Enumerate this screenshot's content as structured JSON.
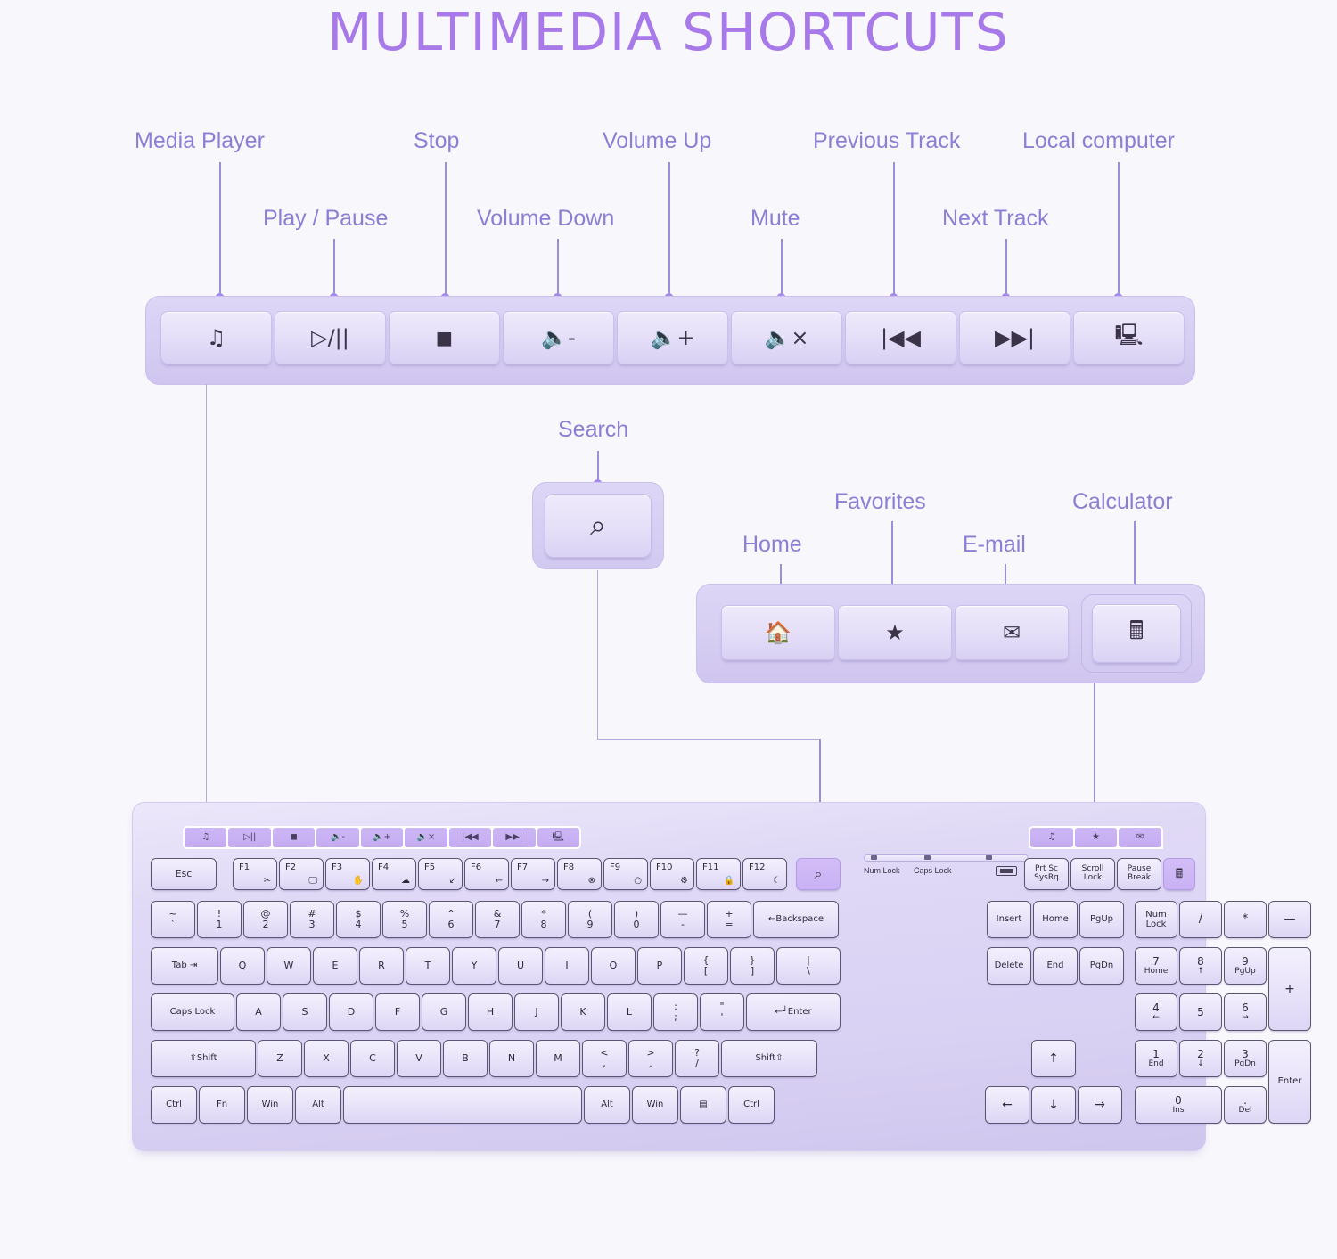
{
  "title": "MULTIMEDIA SHORTCUTS",
  "colors": {
    "background": "#f8f7fc",
    "title_purple": "#a879e8",
    "label_purple": "#8b7fd4",
    "dot_purple": "#a78bea",
    "key_face": "#eae5fa",
    "key_lit": "#cdb7f5",
    "legend_text": "#2f2a3a"
  },
  "media_bar": {
    "keys": [
      {
        "name": "media-player",
        "label": "Media Player",
        "glyph": "♫"
      },
      {
        "name": "play-pause",
        "label": "Play / Pause",
        "glyph": "▷/||"
      },
      {
        "name": "stop",
        "label": "Stop",
        "glyph": "◼"
      },
      {
        "name": "volume-down",
        "label": "Volume Down",
        "glyph": "🔈-"
      },
      {
        "name": "volume-up",
        "label": "Volume Up",
        "glyph": "🔈+"
      },
      {
        "name": "mute",
        "label": "Mute",
        "glyph": "🔈×"
      },
      {
        "name": "previous-track",
        "label": "Previous Track",
        "glyph": "|◀◀"
      },
      {
        "name": "next-track",
        "label": "Next Track",
        "glyph": "▶▶|"
      },
      {
        "name": "local-computer",
        "label": "Local computer",
        "glyph": "🖳"
      }
    ]
  },
  "search_key": {
    "label": "Search",
    "glyph": "⌕"
  },
  "app_bar": {
    "keys": [
      {
        "name": "home",
        "label": "Home",
        "glyph": "🏠"
      },
      {
        "name": "favorites",
        "label": "Favorites",
        "glyph": "★"
      },
      {
        "name": "email",
        "label": "E-mail",
        "glyph": "✉"
      }
    ],
    "calculator": {
      "name": "calculator",
      "label": "Calculator",
      "glyph": "🖩"
    }
  },
  "keyboard": {
    "media_strip_left": [
      "♫",
      "▷||",
      "◼",
      "🔈-",
      "🔈+",
      "🔈×",
      "|◀◀",
      "▶▶|",
      "🖳"
    ],
    "media_strip_right": [
      "♫",
      "★",
      "✉"
    ],
    "search_key": "⌕",
    "calculator_key": "🖩",
    "indicators": {
      "num_lock": "Num Lock",
      "caps_lock": "Caps Lock",
      "battery": "battery"
    },
    "row_function": [
      {
        "main": "Esc",
        "sub": ""
      },
      {
        "main": "F1",
        "sub": "✂"
      },
      {
        "main": "F2",
        "sub": "🖵"
      },
      {
        "main": "F3",
        "sub": "✋"
      },
      {
        "main": "F4",
        "sub": "☁"
      },
      {
        "main": "F5",
        "sub": "↙"
      },
      {
        "main": "F6",
        "sub": "←"
      },
      {
        "main": "F7",
        "sub": "→"
      },
      {
        "main": "F8",
        "sub": "⊗"
      },
      {
        "main": "F9",
        "sub": "○"
      },
      {
        "main": "F10",
        "sub": "⚙"
      },
      {
        "main": "F11",
        "sub": "🔒"
      },
      {
        "main": "F12",
        "sub": "☾"
      }
    ],
    "row_number": [
      {
        "top": "~",
        "bottom": "`"
      },
      {
        "top": "!",
        "bottom": "1"
      },
      {
        "top": "@",
        "bottom": "2"
      },
      {
        "top": "#",
        "bottom": "3"
      },
      {
        "top": "$",
        "bottom": "4"
      },
      {
        "top": "%",
        "bottom": "5"
      },
      {
        "top": "^",
        "bottom": "6"
      },
      {
        "top": "&",
        "bottom": "7"
      },
      {
        "top": "*",
        "bottom": "8"
      },
      {
        "top": "(",
        "bottom": "9"
      },
      {
        "top": ")",
        "bottom": "0"
      },
      {
        "top": "—",
        "bottom": "-"
      },
      {
        "top": "+",
        "bottom": "="
      },
      {
        "top": "",
        "bottom": "←Backspace"
      }
    ],
    "row_qwerty": [
      {
        "top": "",
        "bottom": "Tab"
      },
      {
        "top": "",
        "bottom": "Q"
      },
      {
        "top": "",
        "bottom": "W"
      },
      {
        "top": "",
        "bottom": "E"
      },
      {
        "top": "",
        "bottom": "R"
      },
      {
        "top": "",
        "bottom": "T"
      },
      {
        "top": "",
        "bottom": "Y"
      },
      {
        "top": "",
        "bottom": "U"
      },
      {
        "top": "",
        "bottom": "I"
      },
      {
        "top": "",
        "bottom": "O"
      },
      {
        "top": "",
        "bottom": "P"
      },
      {
        "top": "{",
        "bottom": "["
      },
      {
        "top": "}",
        "bottom": "]"
      },
      {
        "top": "|",
        "bottom": "\\"
      }
    ],
    "row_home": [
      {
        "top": "",
        "bottom": "Caps Lock"
      },
      {
        "top": "",
        "bottom": "A"
      },
      {
        "top": "",
        "bottom": "S"
      },
      {
        "top": "",
        "bottom": "D"
      },
      {
        "top": "",
        "bottom": "F"
      },
      {
        "top": "",
        "bottom": "G"
      },
      {
        "top": "",
        "bottom": "H"
      },
      {
        "top": "",
        "bottom": "J"
      },
      {
        "top": "",
        "bottom": "K"
      },
      {
        "top": "",
        "bottom": "L"
      },
      {
        "top": ":",
        "bottom": ";"
      },
      {
        "top": "\"",
        "bottom": "'"
      },
      {
        "top": "",
        "bottom": "←┘Enter"
      }
    ],
    "row_shift": [
      {
        "top": "",
        "bottom": "⇧Shift"
      },
      {
        "top": "",
        "bottom": "Z"
      },
      {
        "top": "",
        "bottom": "X"
      },
      {
        "top": "",
        "bottom": "C"
      },
      {
        "top": "",
        "bottom": "V"
      },
      {
        "top": "",
        "bottom": "B"
      },
      {
        "top": "",
        "bottom": "N"
      },
      {
        "top": "",
        "bottom": "M"
      },
      {
        "top": "<",
        "bottom": ","
      },
      {
        "top": ">",
        "bottom": "."
      },
      {
        "top": "?",
        "bottom": "/"
      },
      {
        "top": "",
        "bottom": "Shift⇧"
      }
    ],
    "row_bottom": [
      {
        "label": "Ctrl"
      },
      {
        "label": "Fn"
      },
      {
        "label": "Win"
      },
      {
        "label": "Alt"
      },
      {
        "label": ""
      },
      {
        "label": "Alt"
      },
      {
        "label": "Win"
      },
      {
        "label": "▤"
      },
      {
        "label": "Ctrl"
      }
    ],
    "system_keys": [
      {
        "l1": "Prt Sc",
        "l2": "SysRq"
      },
      {
        "l1": "Scroll",
        "l2": "Lock"
      },
      {
        "l1": "Pause",
        "l2": "Break"
      }
    ],
    "nav_cluster": [
      {
        "label": "Insert"
      },
      {
        "label": "Home"
      },
      {
        "label": "PgUp"
      },
      {
        "label": "Delete"
      },
      {
        "label": "End"
      },
      {
        "label": "PgDn"
      }
    ],
    "arrow_keys": [
      {
        "name": "arrow-up",
        "label": "↑"
      },
      {
        "name": "arrow-left",
        "label": "←"
      },
      {
        "name": "arrow-down",
        "label": "↓"
      },
      {
        "name": "arrow-right",
        "label": "→"
      }
    ],
    "numpad": [
      {
        "n": "Num",
        "s": "Lock"
      },
      {
        "n": "/",
        "s": ""
      },
      {
        "n": "*",
        "s": ""
      },
      {
        "n": "—",
        "s": ""
      },
      {
        "n": "7",
        "s": "Home"
      },
      {
        "n": "8",
        "s": "↑"
      },
      {
        "n": "9",
        "s": "PgUp"
      },
      {
        "n": "+",
        "s": ""
      },
      {
        "n": "4",
        "s": "←"
      },
      {
        "n": "5",
        "s": ""
      },
      {
        "n": "6",
        "s": "→"
      },
      {
        "n": "1",
        "s": "End"
      },
      {
        "n": "2",
        "s": "↓"
      },
      {
        "n": "3",
        "s": "PgDn"
      },
      {
        "n": "Enter",
        "s": ""
      },
      {
        "n": "0",
        "s": "Ins"
      },
      {
        "n": ".",
        "s": "Del"
      }
    ]
  }
}
